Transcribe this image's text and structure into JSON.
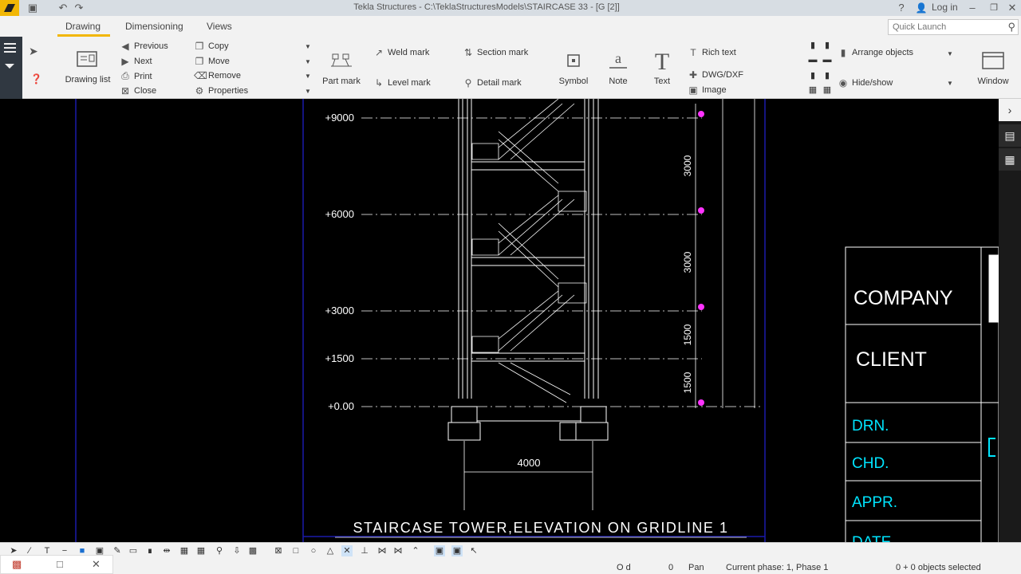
{
  "window": {
    "title": "Tekla Structures - C:\\TeklaStructuresModels\\STAIRCASE 33  - [G  [2]]",
    "help": "?",
    "login": "Log in"
  },
  "menu": {
    "tabs": [
      "Drawing",
      "Dimensioning",
      "Views"
    ],
    "active_tab": "Drawing"
  },
  "quick_launch": {
    "placeholder": "Quick Launch"
  },
  "ribbon": {
    "drawing_list": "Drawing list",
    "previous": "Previous",
    "next": "Next",
    "print": "Print",
    "close": "Close",
    "copy": "Copy",
    "move": "Move",
    "remove": "Remove",
    "properties": "Properties",
    "part_mark": "Part mark",
    "weld_mark": "Weld mark",
    "level_mark": "Level mark",
    "section_mark": "Section mark",
    "detail_mark": "Detail mark",
    "symbol": "Symbol",
    "note": "Note",
    "text": "Text",
    "rich_text": "Rich text",
    "dwg_dxf": "DWG/DXF",
    "image": "Image",
    "arrange_objects": "Arrange objects",
    "hide_show": "Hide/show",
    "window": "Window"
  },
  "drawing": {
    "levels": [
      "+9000",
      "+6000",
      "+3000",
      "+1500",
      "+0.00"
    ],
    "vertical_dims": [
      "3000",
      "3000",
      "1500",
      "1500"
    ],
    "width_dim": "4000",
    "view_title": "STAIRCASE TOWER,ELEVATION ON GRIDLINE 1",
    "title_block": [
      "COMPANY",
      "CLIENT",
      "DRN.",
      "CHD.",
      "APPR.",
      "DATE"
    ]
  },
  "status": {
    "coords": "O d",
    "value": "0",
    "mode": "Pan",
    "phase": "Current phase: 1, Phase 1",
    "selection": "0 + 0 objects selected"
  },
  "colors": {
    "accent": "#f2b705",
    "drawing_bg": "#000000",
    "line": "#ffffff",
    "frame": "#1a1aaa",
    "cyan_text": "#00e5ff",
    "magenta": "#ff33ff"
  }
}
